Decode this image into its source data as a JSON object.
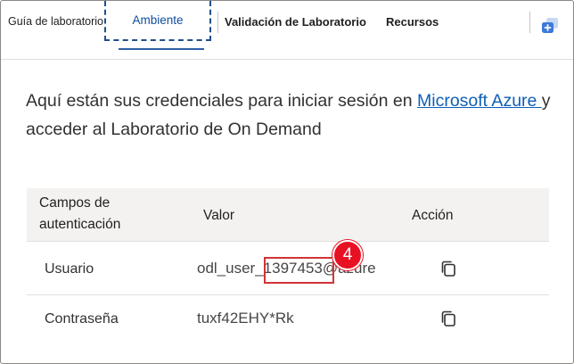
{
  "tabs": {
    "guide": "Guía de laboratorio",
    "environment": "Ambiente",
    "validation": "Validación de Laboratorio",
    "resources": "Recursos"
  },
  "intro": {
    "text_before": "Aquí están sus credenciales para iniciar sesión en ",
    "link": "Microsoft Azure ",
    "text_after": "y acceder al Laboratorio de On Demand"
  },
  "table": {
    "headers": {
      "fields": "Campos de autenticación",
      "value": "Valor",
      "action": "Acción"
    },
    "rows": [
      {
        "label": "Usuario",
        "value": "odl_user_1397453@azure"
      },
      {
        "label": "Contraseña",
        "value": "tuxf42EHY*Rk"
      }
    ]
  },
  "annotation": {
    "badge": "4"
  },
  "colors": {
    "accent": "#0f5fb5",
    "highlight": "#d13438",
    "badge": "#e81123"
  },
  "icons": [
    "expand-panel-icon",
    "copy-icon"
  ]
}
